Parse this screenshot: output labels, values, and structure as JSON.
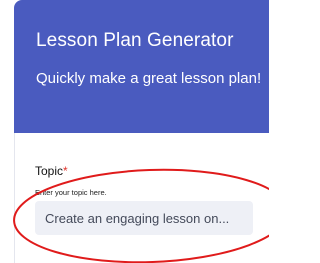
{
  "header": {
    "title": "Lesson Plan Generator",
    "subtitle": "Quickly make a great lesson plan!",
    "background_color": "#4a5bbf"
  },
  "form": {
    "topic": {
      "label": "Topic",
      "required_mark": "*",
      "help_text": "Enter your topic here.",
      "placeholder": "Create an engaging lesson on..."
    }
  },
  "annotation": {
    "shape": "ellipse",
    "color": "#e01b1b"
  }
}
